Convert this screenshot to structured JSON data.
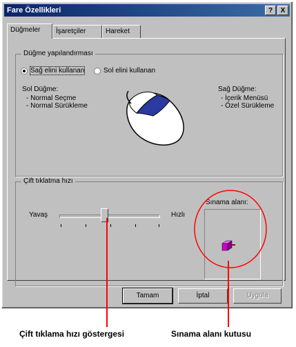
{
  "window": {
    "title": "Fare Özellikleri",
    "help_btn": "?",
    "close_btn": "X"
  },
  "tabs": [
    {
      "label": "Düğmeler"
    },
    {
      "label": "İşaretçiler"
    },
    {
      "label": "Hareket"
    }
  ],
  "button_config": {
    "legend": "Düğme yapılandırması",
    "right_hand_label": "Sağ elini kullanan",
    "left_hand_label": "Sol elini kullanan",
    "left_button_title": "Sol Düğme:",
    "left_button_lines": [
      "- Normal Seçme",
      "- Normal Sürükleme"
    ],
    "right_button_title": "Sağ Düğme:",
    "right_button_lines": [
      "- İçerik Menüsü",
      "- Özel Sürükleme"
    ]
  },
  "double_click": {
    "legend": "Çift tıklatma hızı",
    "slow_label": "Yavaş",
    "fast_label": "Hızlı",
    "test_area_label": "Sınama alanı:",
    "speed_fraction": 0.45
  },
  "buttons": {
    "ok": "Tamam",
    "cancel": "İptal",
    "apply": "Uygula"
  },
  "annotations": {
    "speed_caption": "Çift tıklama hızı göstergesi",
    "test_caption": "Sınama alanı kutusu",
    "color": "#ff0000"
  },
  "colors": {
    "title_start": "#0a246a",
    "title_end": "#3a6ea5",
    "face": "#c0c0c0",
    "jack": "#cc00cc"
  }
}
